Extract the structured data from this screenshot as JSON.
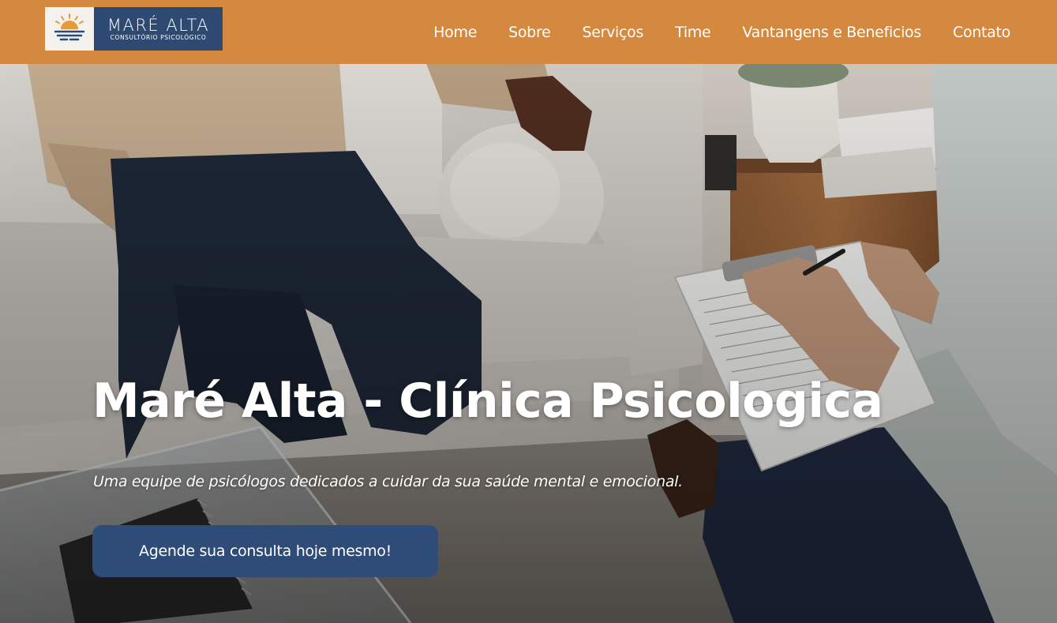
{
  "brand": {
    "title": "MARÉ ALTA",
    "subtitle": "Consultório Psicológico",
    "logo_icon": "sunset-waves-icon",
    "colors": {
      "nav_bg": "#d4893f",
      "brand_blue": "#2e4a72",
      "cta_bg": "#2f4c78"
    }
  },
  "nav": {
    "items": [
      {
        "label": "Home"
      },
      {
        "label": "Sobre"
      },
      {
        "label": "Serviços"
      },
      {
        "label": "Time"
      },
      {
        "label": "Vantangens e Beneficios"
      },
      {
        "label": "Contato"
      }
    ]
  },
  "hero": {
    "title": "Maré Alta - Clínica Psicologica",
    "subtitle": "Uma equipe de psicólogos dedicados a cuidar da sua saúde mental e emocional.",
    "cta_label": "Agende sua consulta hoje mesmo!",
    "background": "therapy-session-photo"
  }
}
